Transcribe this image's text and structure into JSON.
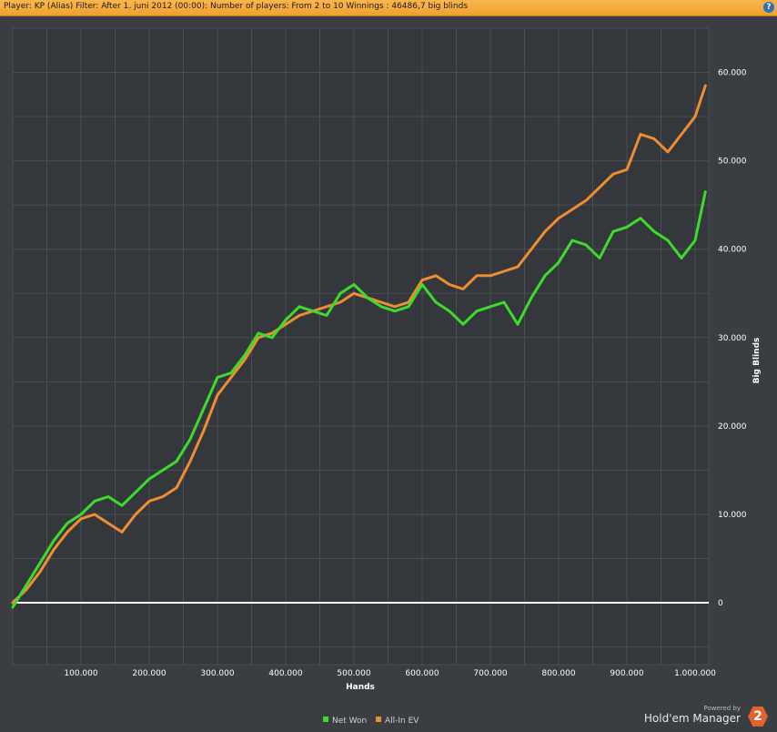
{
  "header": {
    "title": "Player:  KP (Alias)  Filter:  After 1. juni 2012 (00:00): Number of players: From 2 to 10  Winnings :  46486,7 big blinds",
    "help_label": "?"
  },
  "branding": {
    "powered": "Powered by",
    "name": "Hold'em Manager",
    "badge": "2"
  },
  "colors": {
    "background": "#3a3d42",
    "grid": "#4a4e55",
    "axis_text": "#ffffff",
    "net_won": "#3cdc2a",
    "all_in_ev": "#f08c32",
    "zero_line": "#ffffff",
    "header": "#f5a83a"
  },
  "chart_data": {
    "type": "line",
    "xlabel": "Hands",
    "ylabel": "Big Blinds",
    "xlim": [
      0,
      1020000
    ],
    "ylim": [
      -7000,
      65000
    ],
    "x_ticks": [
      100000,
      200000,
      300000,
      400000,
      500000,
      600000,
      700000,
      800000,
      900000,
      1000000
    ],
    "x_tick_labels": [
      "100.000",
      "200.000",
      "300.000",
      "400.000",
      "500.000",
      "600.000",
      "700.000",
      "800.000",
      "900.000",
      "1.000.000"
    ],
    "y_ticks": [
      0,
      10000,
      20000,
      30000,
      40000,
      50000,
      60000
    ],
    "y_tick_labels": [
      "0",
      "10.000",
      "20.000",
      "30.000",
      "40.000",
      "50.000",
      "60.000"
    ],
    "grid": true,
    "legend": "bottom-center",
    "series": [
      {
        "name": "Net Won",
        "color": "#3cdc2a",
        "x": [
          0,
          20000,
          40000,
          60000,
          80000,
          100000,
          120000,
          140000,
          160000,
          180000,
          200000,
          220000,
          240000,
          260000,
          280000,
          300000,
          320000,
          340000,
          360000,
          380000,
          400000,
          420000,
          440000,
          460000,
          480000,
          500000,
          520000,
          540000,
          560000,
          580000,
          600000,
          620000,
          640000,
          660000,
          680000,
          700000,
          720000,
          740000,
          760000,
          780000,
          800000,
          820000,
          840000,
          860000,
          880000,
          900000,
          920000,
          940000,
          960000,
          980000,
          1000000,
          1015000
        ],
        "y": [
          -500,
          2000,
          4500,
          7000,
          9000,
          10000,
          11500,
          12000,
          11000,
          12500,
          14000,
          15000,
          16000,
          18500,
          22000,
          25500,
          26000,
          28000,
          30500,
          30000,
          32000,
          33500,
          33000,
          32500,
          35000,
          36000,
          34500,
          33500,
          33000,
          33500,
          36000,
          34000,
          33000,
          31500,
          33000,
          33500,
          34000,
          31500,
          34500,
          37000,
          38500,
          41000,
          40500,
          39000,
          42000,
          42500,
          43500,
          42000,
          41000,
          39000,
          41000,
          46500
        ]
      },
      {
        "name": "All-In EV",
        "color": "#f08c32",
        "x": [
          0,
          20000,
          40000,
          60000,
          80000,
          100000,
          120000,
          140000,
          160000,
          180000,
          200000,
          220000,
          240000,
          260000,
          280000,
          300000,
          320000,
          340000,
          360000,
          380000,
          400000,
          420000,
          440000,
          460000,
          480000,
          500000,
          520000,
          540000,
          560000,
          580000,
          600000,
          620000,
          640000,
          660000,
          680000,
          700000,
          720000,
          740000,
          760000,
          780000,
          800000,
          820000,
          840000,
          860000,
          880000,
          900000,
          920000,
          940000,
          960000,
          980000,
          1000000,
          1015000
        ],
        "y": [
          0,
          1500,
          3500,
          6000,
          8000,
          9500,
          10000,
          9000,
          8000,
          10000,
          11500,
          12000,
          13000,
          16000,
          19500,
          23500,
          25500,
          27500,
          30000,
          30500,
          31500,
          32500,
          33000,
          33500,
          34000,
          35000,
          34500,
          34000,
          33500,
          34000,
          36500,
          37000,
          36000,
          35500,
          37000,
          37000,
          37500,
          38000,
          40000,
          42000,
          43500,
          44500,
          45500,
          47000,
          48500,
          49000,
          53000,
          52500,
          51000,
          53000,
          55000,
          58500
        ]
      }
    ]
  }
}
